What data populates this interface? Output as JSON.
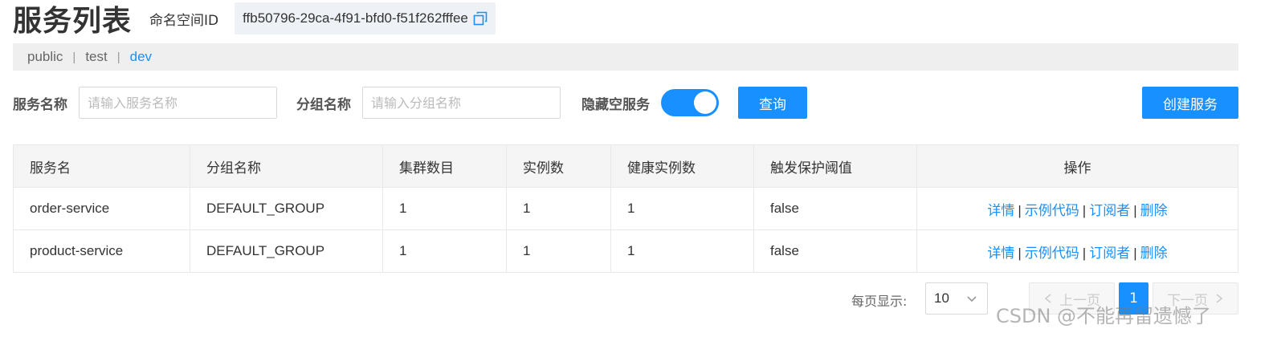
{
  "header": {
    "title": "服务列表",
    "namespace_label": "命名空间ID",
    "namespace_id": "ffb50796-29ca-4f91-bfd0-f51f262fffee"
  },
  "namespace_tabs": [
    {
      "label": "public",
      "active": false
    },
    {
      "label": "test",
      "active": false
    },
    {
      "label": "dev",
      "active": true
    }
  ],
  "tab_separator": "|",
  "filters": {
    "service_name_label": "服务名称",
    "service_name_placeholder": "请输入服务名称",
    "group_name_label": "分组名称",
    "group_name_placeholder": "请输入分组名称",
    "hide_empty_label": "隐藏空服务",
    "hide_empty_on": true,
    "query_button": "查询",
    "create_button": "创建服务"
  },
  "table": {
    "columns": [
      "服务名",
      "分组名称",
      "集群数目",
      "实例数",
      "健康实例数",
      "触发保护阈值",
      "操作"
    ],
    "rows": [
      {
        "service": "order-service",
        "group": "DEFAULT_GROUP",
        "clusters": "1",
        "instances": "1",
        "healthy": "1",
        "threshold": "false"
      },
      {
        "service": "product-service",
        "group": "DEFAULT_GROUP",
        "clusters": "1",
        "instances": "1",
        "healthy": "1",
        "threshold": "false"
      }
    ],
    "actions": [
      "详情",
      "示例代码",
      "订阅者",
      "删除"
    ],
    "action_separator": "|"
  },
  "pagination": {
    "page_size_label": "每页显示:",
    "page_size": "10",
    "prev_label": "上一页",
    "current_page": "1",
    "next_label": "下一页"
  },
  "watermark": "CSDN @不能再留遗憾了",
  "colors": {
    "accent": "#1890ff",
    "tab_bar_bg": "#efefef",
    "table_header_bg": "#f5f5f5"
  },
  "icons": {
    "copy": "copy-icon",
    "dropdown": "chevron-down-icon",
    "prev": "chevron-left-icon",
    "next": "chevron-right-icon"
  }
}
